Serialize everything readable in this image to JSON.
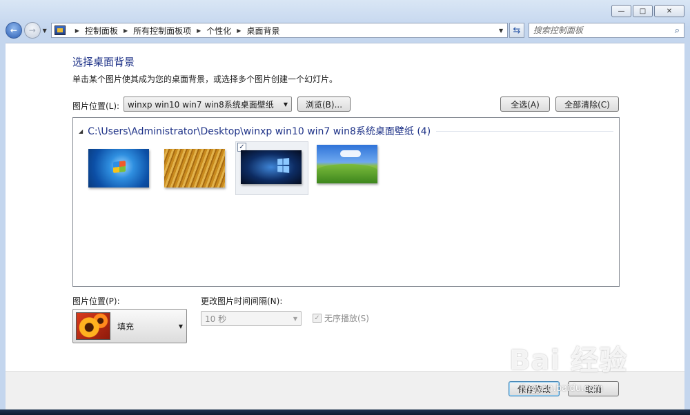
{
  "window": {
    "minimize_symbol": "—",
    "maximize_symbol": "□",
    "close_symbol": "✕"
  },
  "nav": {
    "back_symbol": "←",
    "forward_symbol": "→",
    "breadcrumbs": [
      "控制面板",
      "所有控制面板项",
      "个性化",
      "桌面背景"
    ],
    "refresh_symbol": "⇆",
    "search_placeholder": "搜索控制面板",
    "search_symbol": "⌕"
  },
  "main": {
    "title": "选择桌面背景",
    "subtitle": "单击某个图片使其成为您的桌面背景，或选择多个图片创建一个幻灯片。",
    "location_label": "图片位置(L):",
    "location_value": "winxp win10 win7 win8系统桌面壁纸",
    "browse_label": "浏览(B)...",
    "select_all_label": "全选(A)",
    "clear_all_label": "全部清除(C)",
    "group_title": "C:\\Users\\Administrator\\Desktop\\winxp win10 win7 win8系统桌面壁纸 (4)",
    "thumbnails": [
      "windows7-wallpaper",
      "wheat-wallpaper",
      "windows10-wallpaper",
      "windowsxp-bliss-wallpaper"
    ],
    "selected_check": "✓"
  },
  "options": {
    "position_label": "图片位置(P):",
    "position_value": "填充",
    "interval_label": "更改图片时间间隔(N):",
    "interval_value": "10 秒",
    "shuffle_label": "无序播放(S)",
    "shuffle_check": "✓"
  },
  "footer": {
    "save_label": "保存修改",
    "cancel_label": "取消"
  },
  "watermark": {
    "main": "Bai 经验",
    "sub": "jingyan.baidu.com"
  },
  "colors": {
    "title_blue": "#1e3287",
    "window_frame": "#c4d6ee"
  }
}
